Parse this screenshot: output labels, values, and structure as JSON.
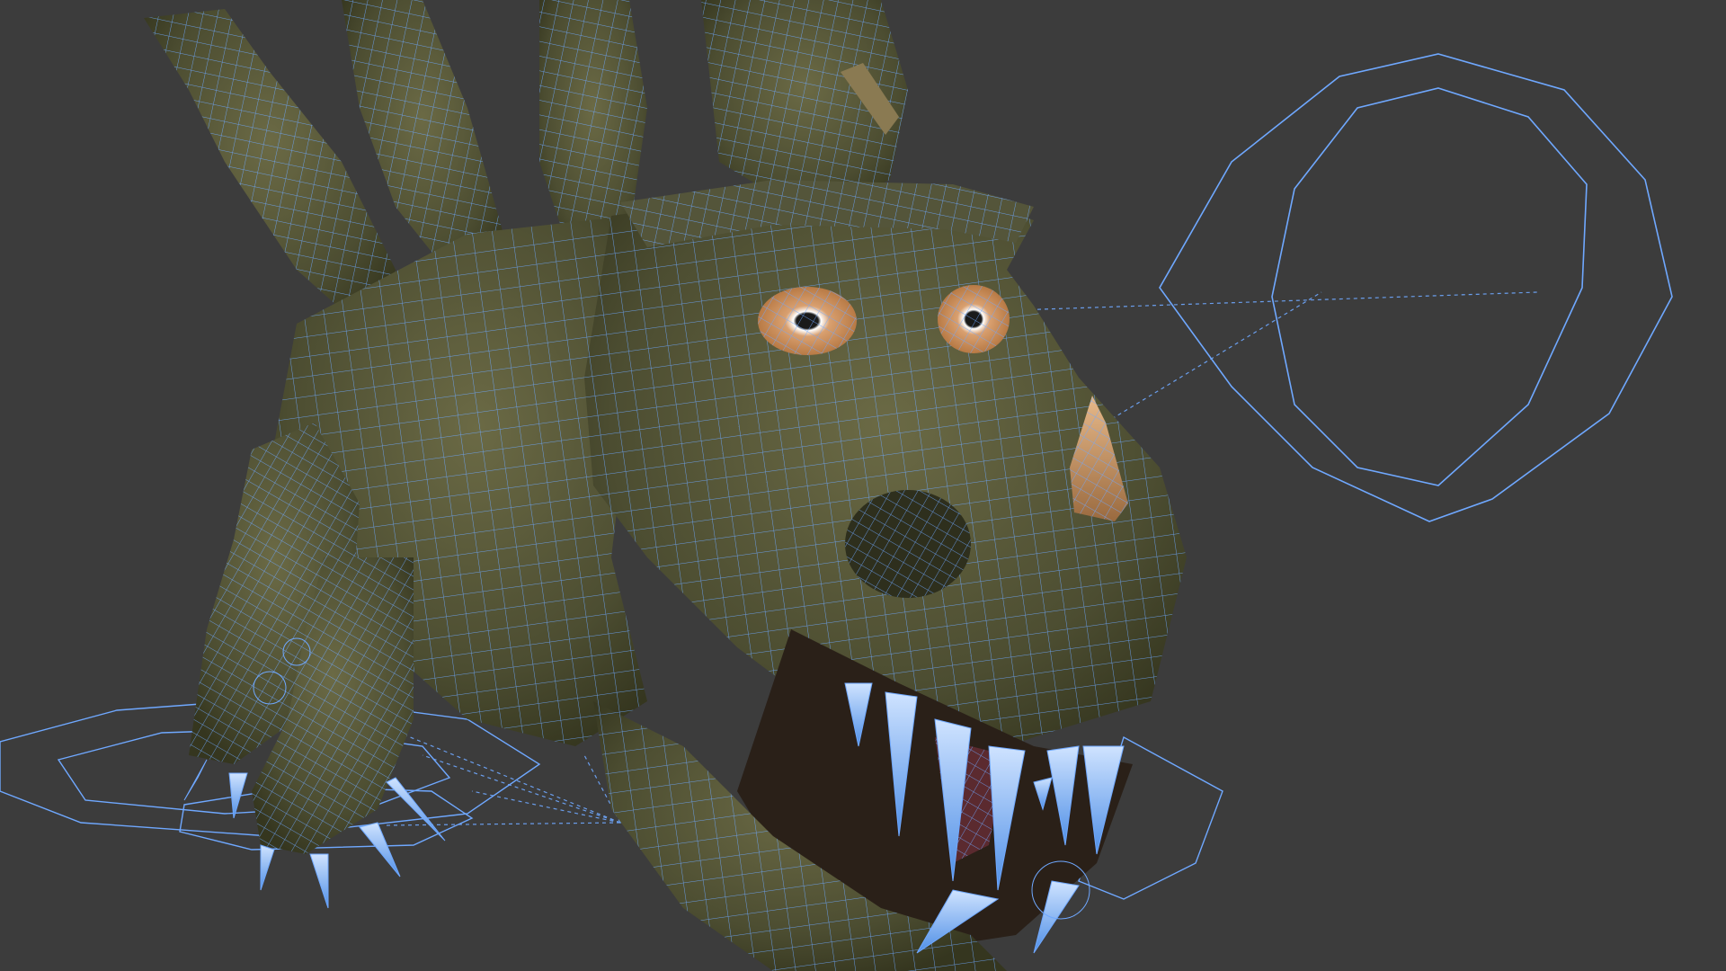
{
  "viewport": {
    "background": "#3c3c3c",
    "wire_color": "#6fa8ff",
    "skin_color": "#5a5a3a",
    "skin_dark": "#3e3f28",
    "mouth_color": "#2a2018",
    "eye_color": "#c8884a",
    "horn_color": "#c9955e",
    "claw_color": "#7ab4ff",
    "controls": [
      "head-control",
      "foot-control"
    ]
  }
}
